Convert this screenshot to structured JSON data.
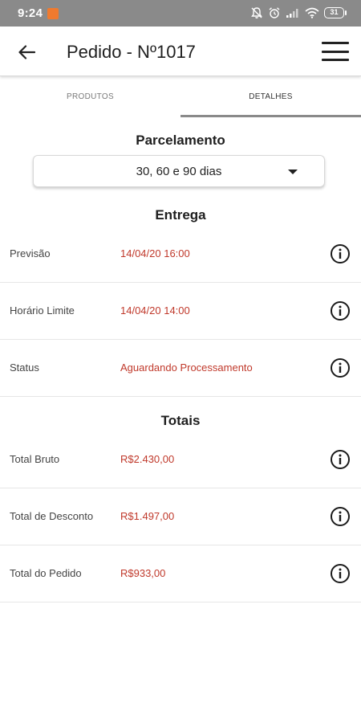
{
  "status_bar": {
    "time": "9:24",
    "battery": "31",
    "icons": [
      "notification-app-icon",
      "mute-bell-icon",
      "alarm-icon",
      "signal-icon",
      "wifi-icon",
      "battery-icon"
    ]
  },
  "app_bar": {
    "title": "Pedido - Nº1017",
    "back_icon": "arrow-left-icon",
    "menu_icon": "hamburger-menu-icon"
  },
  "tabs": [
    {
      "label": "PRODUTOS",
      "active": false
    },
    {
      "label": "DETALHES",
      "active": true
    }
  ],
  "parcelamento": {
    "title": "Parcelamento",
    "selected": "30, 60 e 90 dias"
  },
  "entrega": {
    "title": "Entrega",
    "rows": [
      {
        "label": "Previsão",
        "value": "14/04/20 16:00"
      },
      {
        "label": "Horário Limite",
        "value": "14/04/20 14:00"
      },
      {
        "label": "Status",
        "value": "Aguardando Processamento"
      }
    ]
  },
  "totais": {
    "title": "Totais",
    "rows": [
      {
        "label": "Total Bruto",
        "value": "R$2.430,00"
      },
      {
        "label": "Total de Desconto",
        "value": "R$1.497,00"
      },
      {
        "label": "Total do Pedido",
        "value": "R$933,00"
      }
    ]
  },
  "colors": {
    "value_text": "#c0392b",
    "status_bar": "#8a8a8a",
    "notification": "#f07a2e",
    "tab_indicator": "#8a8a8a"
  }
}
